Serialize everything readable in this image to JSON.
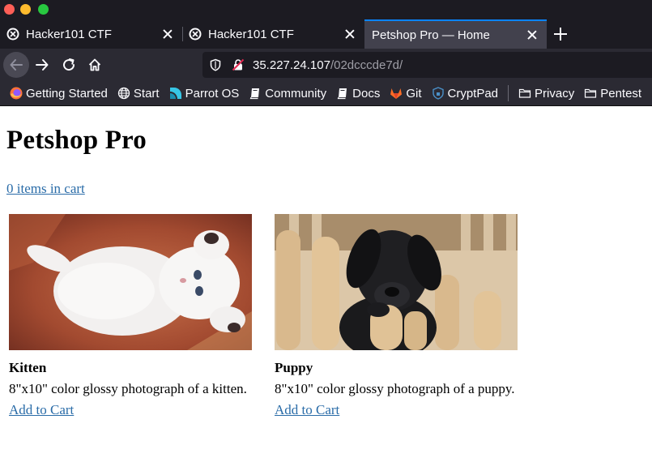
{
  "browser": {
    "tabs": [
      {
        "title": "Hacker101 CTF",
        "icon": "hacker101-icon",
        "active": false
      },
      {
        "title": "Hacker101 CTF",
        "icon": "hacker101-icon",
        "active": false
      },
      {
        "title": "Petshop Pro — Home",
        "icon": "",
        "active": true
      }
    ],
    "url": {
      "host": "35.227.24.107",
      "path": "/02dcccde7d/"
    },
    "bookmarks": [
      {
        "label": "Getting Started",
        "icon": "firefox-icon"
      },
      {
        "label": "Start",
        "icon": "globe-icon"
      },
      {
        "label": "Parrot OS",
        "icon": "parrot-icon"
      },
      {
        "label": "Community",
        "icon": "book-icon"
      },
      {
        "label": "Docs",
        "icon": "book-icon"
      },
      {
        "label": "Git",
        "icon": "gitlab-icon"
      },
      {
        "label": "CryptPad",
        "icon": "cryptpad-icon"
      },
      {
        "label": "Privacy",
        "icon": "folder-icon"
      },
      {
        "label": "Pentest",
        "icon": "folder-icon"
      }
    ],
    "accent": "#0a84ff"
  },
  "page": {
    "title": "Petshop Pro",
    "cart_link": "0 items in cart",
    "products": [
      {
        "name": "Kitten",
        "description": "8\"x10\" color glossy photograph of a kitten.",
        "add_label": "Add to Cart",
        "photo": "kitten-photo"
      },
      {
        "name": "Puppy",
        "description": "8\"x10\" color glossy photograph of a puppy.",
        "add_label": "Add to Cart",
        "photo": "puppy-photo"
      }
    ],
    "link_color": "#2a6ca8"
  }
}
